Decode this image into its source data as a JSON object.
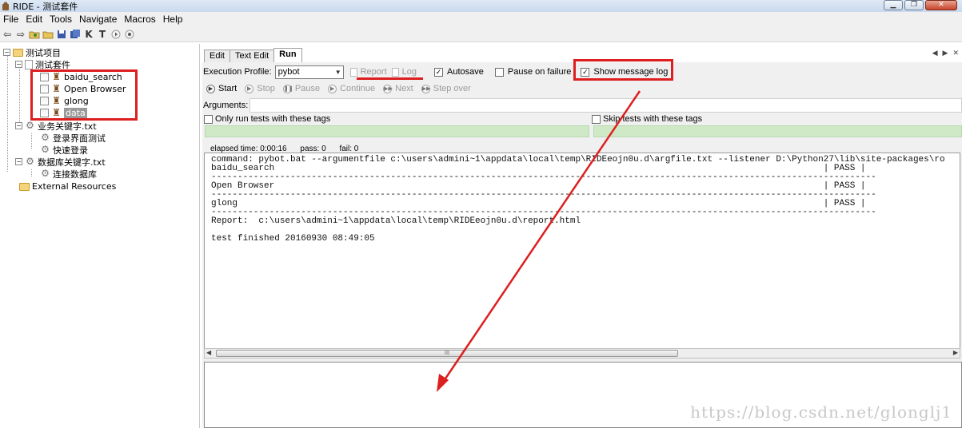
{
  "window": {
    "title": "RIDE - 测试套件",
    "controls": [
      "minimize",
      "restore",
      "close"
    ]
  },
  "menu": [
    "File",
    "Edit",
    "Tools",
    "Navigate",
    "Macros",
    "Help"
  ],
  "toolbar_icons": [
    "back-icon",
    "forward-icon",
    "open-folder-icon",
    "open-directory-icon",
    "save-icon",
    "save-all-icon",
    "keyword-search-icon",
    "test-search-icon",
    "run-icon",
    "stop-icon"
  ],
  "toolbar_letters": {
    "k": "K",
    "t": "T"
  },
  "tree": {
    "root": "测试项目",
    "suite": "测试套件",
    "tests": [
      "baidu_search",
      "Open Browser",
      "glong",
      "data"
    ],
    "resource1": "业务关键字.txt",
    "resource1_items": [
      "登录界面测试",
      "快速登录"
    ],
    "resource2": "数据库关键字.txt",
    "resource2_items": [
      "连接数据库"
    ],
    "external": "External Resources"
  },
  "tabs": [
    "Edit",
    "Text Edit",
    "Run"
  ],
  "active_tab": "Run",
  "run": {
    "profile_label": "Execution Profile:",
    "profile_value": "pybot",
    "report_label": "Report",
    "log_label": "Log",
    "autosave_label": "Autosave",
    "autosave_checked": true,
    "pause_label": "Pause on failure",
    "pause_checked": false,
    "show_log_label": "Show message log",
    "show_log_checked": true,
    "buttons": [
      "Start",
      "Stop",
      "Pause",
      "Continue",
      "Next",
      "Step over"
    ],
    "arguments_label": "Arguments:",
    "only_run_label": "Only run tests with these tags",
    "skip_label": "Skip tests with these tags",
    "elapsed": "elapsed time: 0:00:16",
    "pass": "pass: 0",
    "fail": "fail: 0"
  },
  "output_lines": [
    "command: pybot.bat --argumentfile c:\\users\\admini~1\\appdata\\local\\temp\\RIDEeojn0u.d\\argfile.txt --listener D:\\Python27\\lib\\site-packages\\ro",
    "baidu_search                                                                                                        | PASS |",
    "------------------------------------------------------------------------------------------------------------------------------",
    "Open Browser                                                                                                        | PASS |",
    "------------------------------------------------------------------------------------------------------------------------------",
    "glong                                                                                                               | PASS |",
    "------------------------------------------------------------------------------------------------------------------------------",
    "Report:  c:\\users\\admini~1\\appdata\\local\\temp\\RIDEeojn0u.d\\report.html",
    "",
    "test finished 20160930 08:49:05"
  ],
  "scrollbar_grip": "III",
  "watermark": "https://blog.csdn.net/glonglj1",
  "annotation_color": "#dd1f1f"
}
